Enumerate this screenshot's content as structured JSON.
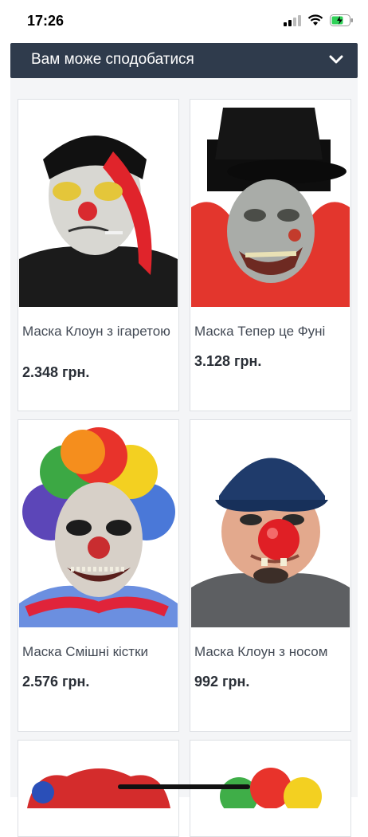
{
  "status": {
    "time": "17:26",
    "icons": [
      "cellular-signal-icon",
      "wifi-icon",
      "battery-charging-icon"
    ]
  },
  "section": {
    "title": "Вам може сподобатися"
  },
  "products": [
    {
      "title": "Маска Клоун з ігаретою",
      "price": "2.348 грн."
    },
    {
      "title": "Маска Тепер це Фуні",
      "price": "3.128 грн."
    },
    {
      "title": "Маска Смішні кістки",
      "price": "2.576 грн."
    },
    {
      "title": "Маска Клоун з носом",
      "price": "992 грн."
    }
  ],
  "colors": {
    "header_bg": "#2f3b4c",
    "panel_bg": "#f4f5f7",
    "price_text": "#2a2f37"
  }
}
